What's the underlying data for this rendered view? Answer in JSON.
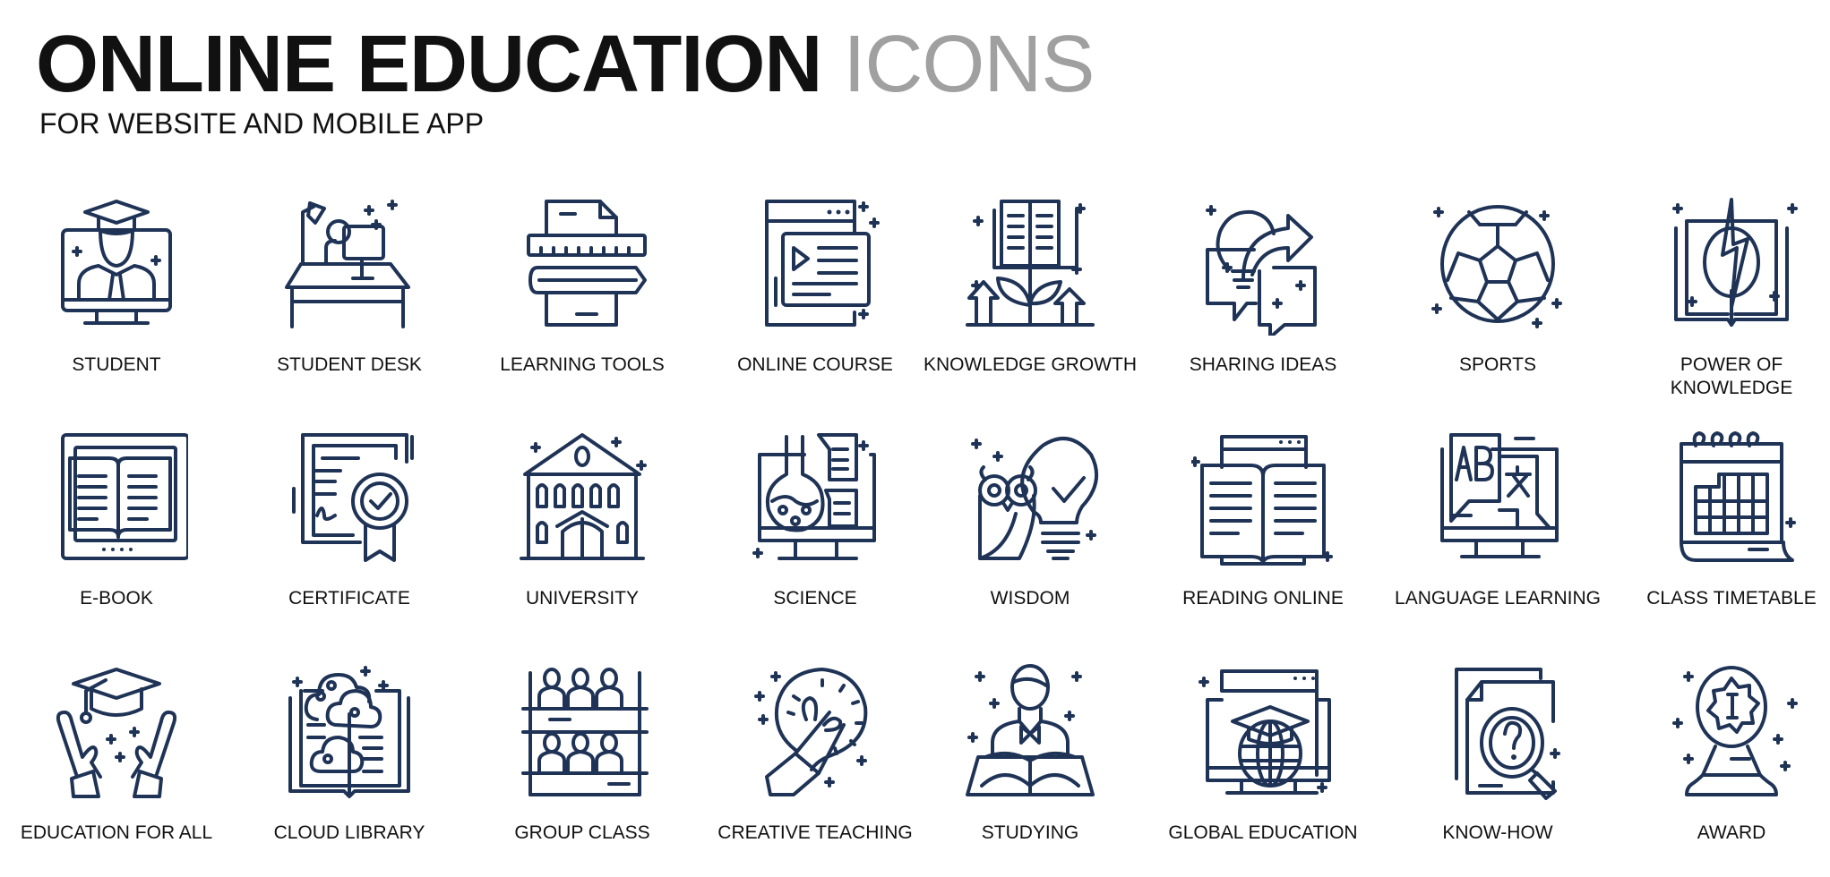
{
  "header": {
    "title_bold": "ONLINE EDUCATION",
    "title_light": "ICONS",
    "subtitle": "FOR WEBSITE AND MOBILE APP"
  },
  "style": {
    "icon_color": "#1f3356",
    "title_light_color": "#a0a0a0"
  },
  "icons": [
    {
      "label": "STUDENT",
      "icon": "student-icon"
    },
    {
      "label": "STUDENT DESK",
      "icon": "student-desk-icon"
    },
    {
      "label": "LEARNING TOOLS",
      "icon": "learning-tools-icon"
    },
    {
      "label": "ONLINE COURSE",
      "icon": "online-course-icon"
    },
    {
      "label": "KNOWLEDGE GROWTH",
      "icon": "knowledge-growth-icon"
    },
    {
      "label": "SHARING IDEAS",
      "icon": "sharing-ideas-icon"
    },
    {
      "label": "SPORTS",
      "icon": "soccer-ball-icon"
    },
    {
      "label": "POWER OF\nKNOWLEDGE",
      "icon": "power-of-knowledge-icon"
    },
    {
      "label": "E-BOOK",
      "icon": "ebook-icon"
    },
    {
      "label": "CERTIFICATE",
      "icon": "certificate-icon"
    },
    {
      "label": "UNIVERSITY",
      "icon": "university-icon"
    },
    {
      "label": "SCIENCE",
      "icon": "science-icon"
    },
    {
      "label": "WISDOM",
      "icon": "wisdom-owl-icon"
    },
    {
      "label": "READING ONLINE",
      "icon": "reading-online-icon"
    },
    {
      "label": "LANGUAGE LEARNING",
      "icon": "language-learning-icon"
    },
    {
      "label": "CLASS TIMETABLE",
      "icon": "class-timetable-icon"
    },
    {
      "label": "EDUCATION FOR ALL",
      "icon": "education-for-all-icon"
    },
    {
      "label": "CLOUD LIBRARY",
      "icon": "cloud-library-icon"
    },
    {
      "label": "GROUP CLASS",
      "icon": "group-class-icon"
    },
    {
      "label": "CREATIVE TEACHING",
      "icon": "creative-teaching-icon"
    },
    {
      "label": "STUDYING",
      "icon": "studying-icon"
    },
    {
      "label": "GLOBAL EDUCATION",
      "icon": "global-education-icon"
    },
    {
      "label": "KNOW-HOW",
      "icon": "know-how-icon"
    },
    {
      "label": "AWARD",
      "icon": "award-icon"
    }
  ]
}
